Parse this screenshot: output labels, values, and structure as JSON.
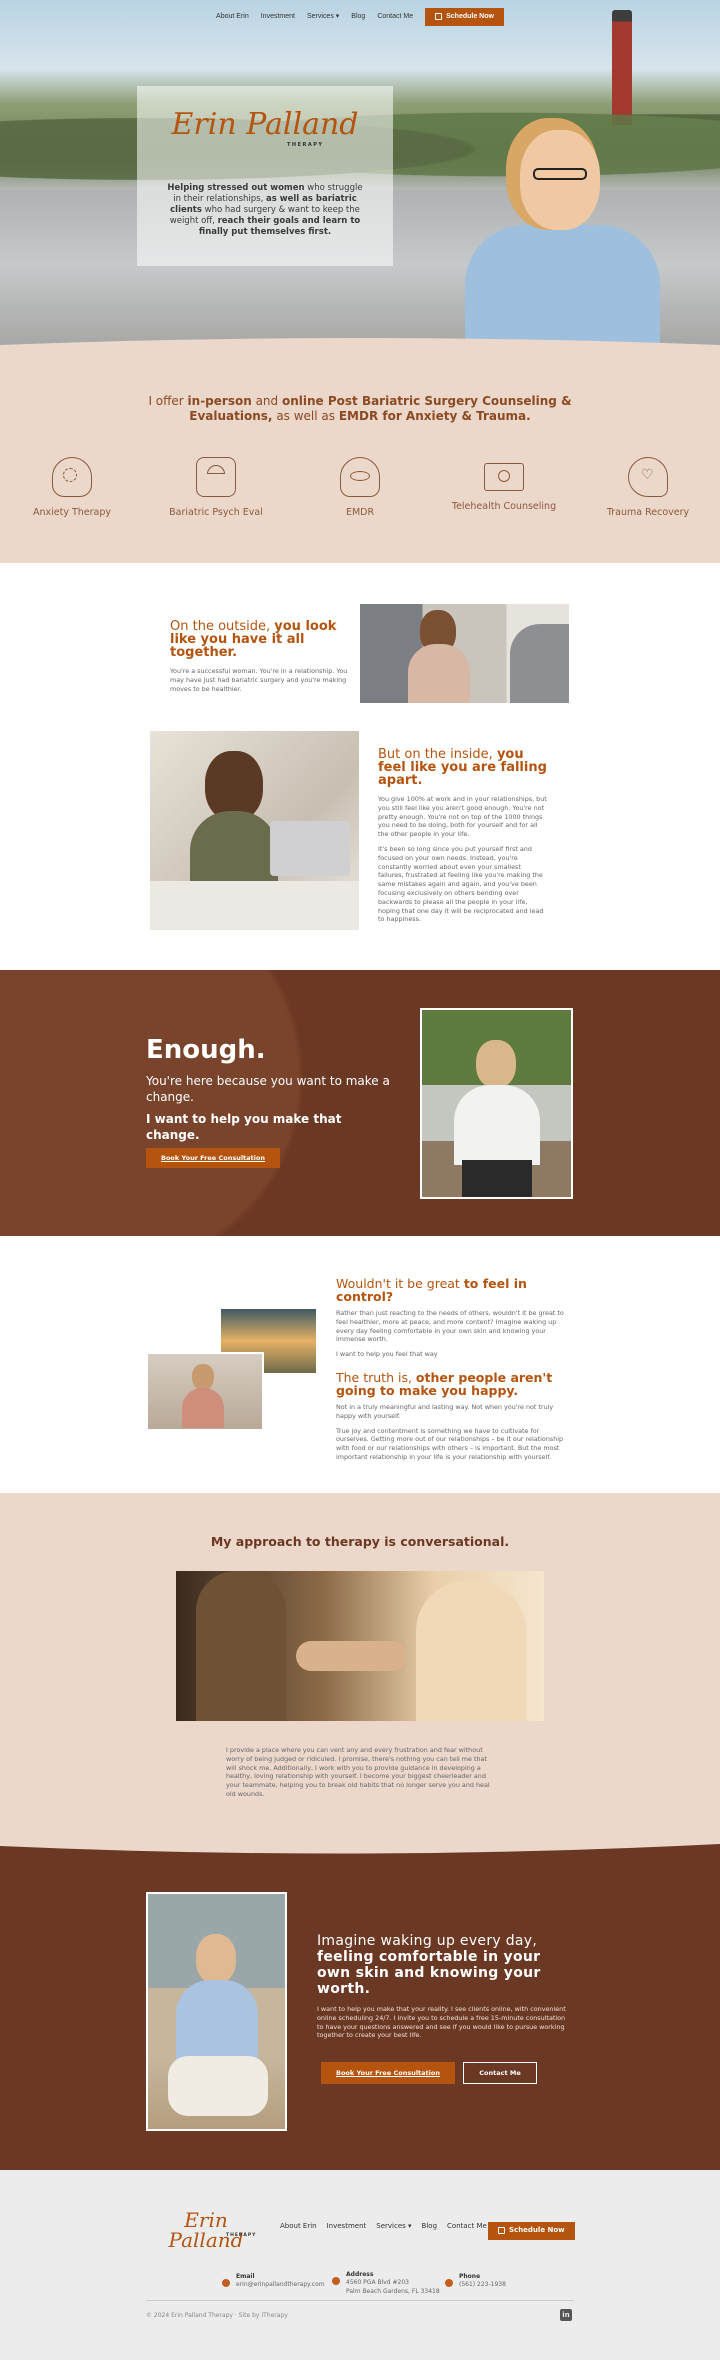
{
  "nav": {
    "items": [
      "About Erin",
      "Investment",
      "Services",
      "Blog",
      "Contact Me"
    ],
    "schedule": "Schedule Now"
  },
  "hero": {
    "logo": "Erin Palland",
    "logo_sub": "THERAPY",
    "text_b1": "Helping stressed out women",
    "text_1": " who struggle in their relationships, ",
    "text_b2": "as well as bariatric clients",
    "text_2": " who had surgery & want to keep the weight off, ",
    "text_b3": "reach their goals and learn to finally put themselves first."
  },
  "offer": {
    "h_1": "I offer ",
    "h_b1": "in-person",
    "h_2": " and ",
    "h_b2": "online Post Bariatric Surgery Counseling & Evaluations,",
    "h_3": " as well as ",
    "h_b3": "EMDR for Anxiety & Trauma."
  },
  "services": [
    {
      "label": "Anxiety Therapy",
      "icon": "head-gear-icon"
    },
    {
      "label": "Bariatric Psych Eval",
      "icon": "scale-icon"
    },
    {
      "label": "EMDR",
      "icon": "eye-hand-icon"
    },
    {
      "label": "Telehealth Counseling",
      "icon": "laptop-icon"
    },
    {
      "label": "Trauma Recovery",
      "icon": "heart-head-icon"
    }
  ],
  "outside": {
    "h_1": "On the outside, ",
    "h_b": "you look like you have it all together.",
    "p": "You're a successful woman. You're in a relationship. You may have just had bariatric surgery and you're making moves to be healthier."
  },
  "inside": {
    "h_1": "But on the inside, ",
    "h_b": "you feel like you are falling apart.",
    "p1": "You give 100% at work and in your relationships, but you still feel like you aren't good enough. You're not pretty enough. You're not on top of the 1000 things you need to be doing, both for yourself and for all the other people in your life.",
    "p2": "It's been so long since you put yourself first and focused on your own needs. Instead, you're constantly worried about even your smallest failures, frustrated at feeling like you're making the same mistakes again and again, and you've been focusing exclusively on others bending over backwards to please all the people in your life, hoping that one day it will be reciprocated and lead to happiness."
  },
  "enough": {
    "title": "Enough.",
    "sub": "You're here because you want to make a change.",
    "bold": "I want to help you make that change.",
    "button": "Book Your Free Consultation"
  },
  "control": {
    "h1_1": "Wouldn't it be great ",
    "h1_b": "to feel in control?",
    "p1": "Rather than just reacting to the needs of others, wouldn't it be great to feel healthier, more at peace, and more content? Imagine waking up every day feeling comfortable in your own skin and knowing your immense worth.",
    "p2": "I want to help you feel that way",
    "h2_1": "The truth is, ",
    "h2_b": "other people aren't going to make you happy.",
    "p3": "Not in a truly meaningful and lasting way. Not when you're not truly happy with yourself.",
    "p4": "True joy and contentment is something we have to cultivate for ourselves. Getting more out of our relationships – be it our relationship with food or our relationships with others – is important. But the most important relationship in your life is your relationship with yourself."
  },
  "approach": {
    "title": "My approach to therapy is conversational.",
    "p": "I provide a place where you can vent any and every frustration and fear without worry of being judged or ridiculed. I promise, there's nothing you can tell me that will shock me. Additionally, I work with you to provide guidance in developing a healthy, loving relationship with yourself. I become your biggest cheerleader and your teammate, helping you to break old habits that no longer serve you and heal old wounds."
  },
  "imagine": {
    "h_1": "Imagine waking up every day, ",
    "h_b": "feeling comfortable in your own skin and knowing your worth.",
    "p": "I want to help you make that your reality. I see clients online, with convenient online scheduling 24/7. I invite you to schedule a free 15-minute consultation to have your questions answered and see if you would like to pursue working together to create your best life.",
    "button1": "Book Your Free Consultation",
    "button2": "Contact Me"
  },
  "footer": {
    "email_label": "Email",
    "email": "erin@erinpallandtherapy.com",
    "address_label": "Address",
    "address1": "4560 PGA Blvd #203",
    "address2": "Palm Beach Gardens, FL 33418",
    "phone_label": "Phone",
    "phone": "(561) 223-1938",
    "copyright": "© 2024 Erin Palland Therapy · Site by ITherapy"
  },
  "colors": {
    "accent": "#b5540e",
    "brown": "#6b3823",
    "blush": "#ecd7cb"
  }
}
